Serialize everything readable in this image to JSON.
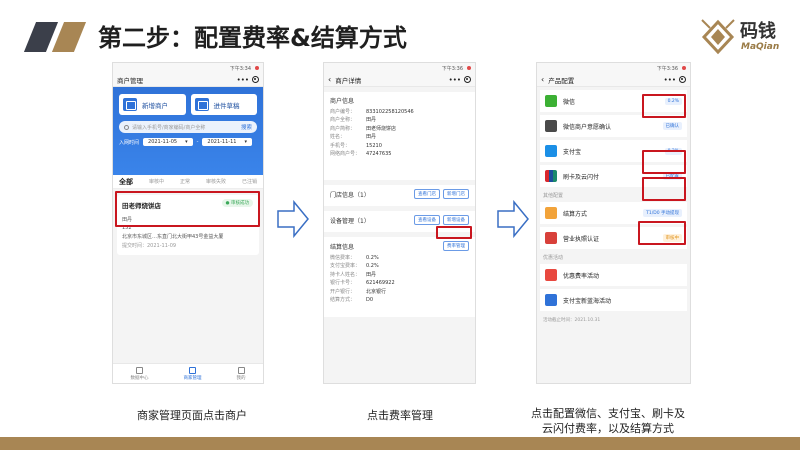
{
  "slide": {
    "title": "第二步：配置费率&结算方式",
    "logo_cn": "码钱",
    "logo_en": "MaQian"
  },
  "captions": {
    "step1": "商家管理页面点击商户",
    "step2": "点击费率管理",
    "step3_line1": "点击配置微信、支付宝、刷卡及",
    "step3_line2": "云闪付费率，以及结算方式"
  },
  "colors": {
    "accent_gold": "#a88654",
    "deco_dark": "#3b3f4a",
    "app_blue": "#2f72d8",
    "highlight_red": "#c9161f"
  },
  "phone1": {
    "status_time": "下午3:34",
    "nav_title": "商户管理",
    "hero_buttons": [
      "新增商户",
      "进件草稿"
    ],
    "search_placeholder": "请输入手机号/商家编码/商户全称",
    "search_button": "搜索",
    "date_label": "入网时间",
    "date_start": "2021-11-05",
    "date_sep": "-",
    "date_end": "2021-11-11",
    "tabs": [
      "全部",
      "审核中",
      "正常",
      "审核失败",
      "已注销"
    ],
    "card": {
      "name": "田老师烧饼店",
      "status": "● 审核成功",
      "person": "田丹",
      "phone": "152",
      "address": "北京市东城区…东直门北大街甲43号金益大厦",
      "time": "提交时间：2021-11-09"
    },
    "tabbar": [
      "数据中心",
      "商家管理",
      "我的"
    ]
  },
  "phone2": {
    "status_time": "下午3:36",
    "nav_title": "商户详情",
    "info_title": "商户信息",
    "info_rows": [
      {
        "k": "商户编号：",
        "v": "833102258120546"
      },
      {
        "k": "商户全称：",
        "v": "田丹"
      },
      {
        "k": "商户简称：",
        "v": "田老师烧饼店"
      },
      {
        "k": "姓名：",
        "v": "田丹"
      },
      {
        "k": "手机号：",
        "v": "15210"
      },
      {
        "k": "网络商户号：",
        "v": "47247635"
      }
    ],
    "store_title": "门店信息（1）",
    "store_buttons": [
      "查看门店",
      "新增门店"
    ],
    "device_title": "设备管理（1）",
    "device_buttons": [
      "查看设备",
      "新增设备"
    ],
    "settle_title": "结算信息",
    "fee_button": "费率管理",
    "settle_rows": [
      {
        "k": "微信费率：",
        "v": "0.2%"
      },
      {
        "k": "支付宝费率：",
        "v": "0.2%"
      },
      {
        "k": "持卡人姓名：",
        "v": "田丹"
      },
      {
        "k": "银行卡号：",
        "v": "621469922"
      },
      {
        "k": "开户银行：",
        "v": "北京银行"
      },
      {
        "k": "结算方式：",
        "v": "D0"
      }
    ]
  },
  "phone3": {
    "status_time": "下午3:36",
    "nav_title": "产品配置",
    "products": [
      {
        "label": "微信",
        "badge": "0.2%"
      },
      {
        "label": "微信商户意愿确认",
        "badge": "已确认"
      },
      {
        "label": "支付宝",
        "badge": "0.2%"
      },
      {
        "label": "刷卡及云闪付",
        "badge": "已配置"
      }
    ],
    "group_other": "其他配置",
    "others": [
      {
        "label": "结算方式",
        "badge": "T1/D0 手动提现"
      },
      {
        "label": "营业执照认证",
        "badge": "审核中"
      }
    ],
    "group_promo": "优惠活动",
    "promos": [
      {
        "label": "优惠费率活动"
      },
      {
        "label": "支付宝新蓝海活动"
      }
    ],
    "footnote": "活动截止时间：2021.10.31"
  }
}
